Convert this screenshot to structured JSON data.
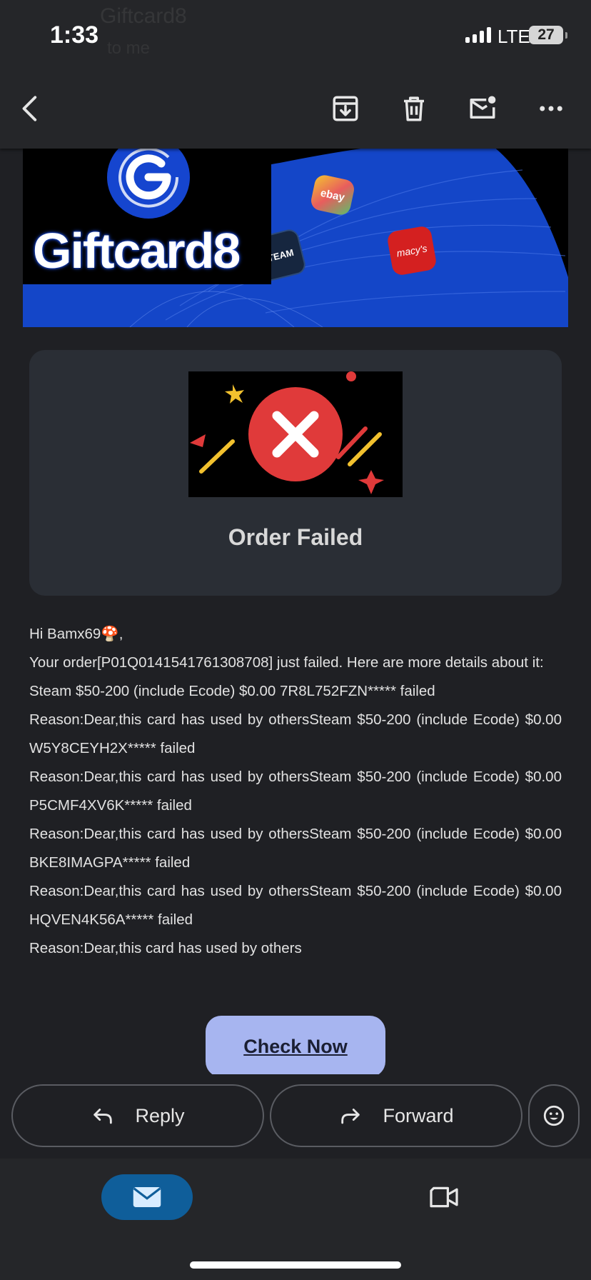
{
  "status_bar": {
    "time": "1:33",
    "network": "LTE",
    "battery": "27"
  },
  "header_underlay": {
    "sender": "Giftcard8",
    "subtitle": "to me"
  },
  "toolbar": {
    "icons": [
      "back-icon",
      "archive-icon",
      "trash-icon",
      "mark-unread-icon",
      "more-icon"
    ]
  },
  "banner": {
    "brand": "Giftcard8",
    "cards": [
      "ebay",
      "STEAM",
      "macy's"
    ],
    "colors": {
      "brand_blue": "#1545cf",
      "banner_bg": "#000000"
    }
  },
  "status_card": {
    "title": "Order Failed",
    "colors": {
      "card_bg": "#2a2e35",
      "error_red": "#e03a3a"
    }
  },
  "message": {
    "greeting": "Hi Bamx69🍄,",
    "intro": "Your order[P01Q0141541761308708] just failed. Here are more details about it:",
    "lines": [
      "Steam $50-200 (include Ecode) $0.00 7R8L752FZN***** failed",
      "Reason:Dear,this card has used by othersSteam $50-200 (include Ecode) $0.00 W5Y8CEYH2X***** failed",
      "Reason:Dear,this card has used by othersSteam $50-200 (include Ecode) $0.00 P5CMF4XV6K***** failed",
      "Reason:Dear,this card has used by othersSteam $50-200 (include Ecode) $0.00 BKE8IMAGPA***** failed",
      "Reason:Dear,this card has used by othersSteam $50-200 (include Ecode) $0.00 HQVEN4K56A***** failed",
      "Reason:Dear,this card has used by others"
    ]
  },
  "cta": {
    "label": "Check Now",
    "color": "#a7b5f0"
  },
  "actions": {
    "reply": "Reply",
    "forward": "Forward"
  },
  "bottom_nav": {
    "tabs": [
      "mail-icon",
      "video-icon"
    ],
    "active_color": "#0f5e9a"
  }
}
